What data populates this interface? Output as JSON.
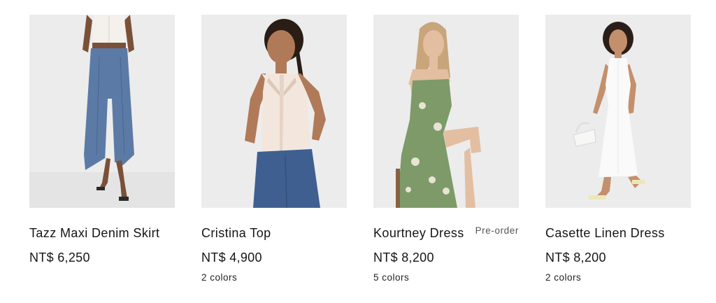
{
  "products": [
    {
      "name": "Tazz Maxi Denim Skirt",
      "price": "NT$ 6,250",
      "colors": "",
      "badge": "",
      "image": "model-in-denim-maxi-skirt"
    },
    {
      "name": "Cristina Top",
      "price": "NT$ 4,900",
      "colors": "2 colors",
      "badge": "",
      "image": "model-in-cream-lace-top"
    },
    {
      "name": "Kourtney Dress",
      "price": "NT$ 8,200",
      "colors": "5 colors",
      "badge": "Pre-order",
      "image": "model-in-green-floral-dress"
    },
    {
      "name": "Casette Linen Dress",
      "price": "NT$ 8,200",
      "colors": "2 colors",
      "badge": "",
      "image": "model-in-white-linen-dress"
    }
  ],
  "palette": {
    "photo_background": "#ececec",
    "denim": "#5b7aa6",
    "floral_green": "#7d9a68",
    "cream": "#f3e6dc",
    "text": "#151515",
    "muted": "#555555"
  }
}
